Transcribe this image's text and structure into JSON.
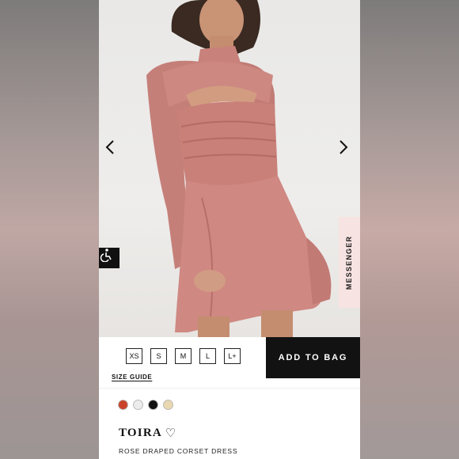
{
  "product_gallery": {
    "prev_icon": "chevron-left-icon",
    "next_icon": "chevron-right-icon",
    "accessibility_icon": "accessibility-icon",
    "messenger_label": "MESSENGER"
  },
  "size_selector": {
    "sizes": [
      "XS",
      "S",
      "M",
      "L",
      "L+"
    ],
    "size_guide_label": "SIZE GUIDE",
    "add_to_bag_label": "ADD TO BAG"
  },
  "product": {
    "colors": [
      "#c9432b",
      "#ececec",
      "#111111",
      "#e9d8b0"
    ],
    "name": "TOIRA",
    "heart_icon": "♡",
    "description": "ROSE DRAPED CORSET DRESS"
  }
}
